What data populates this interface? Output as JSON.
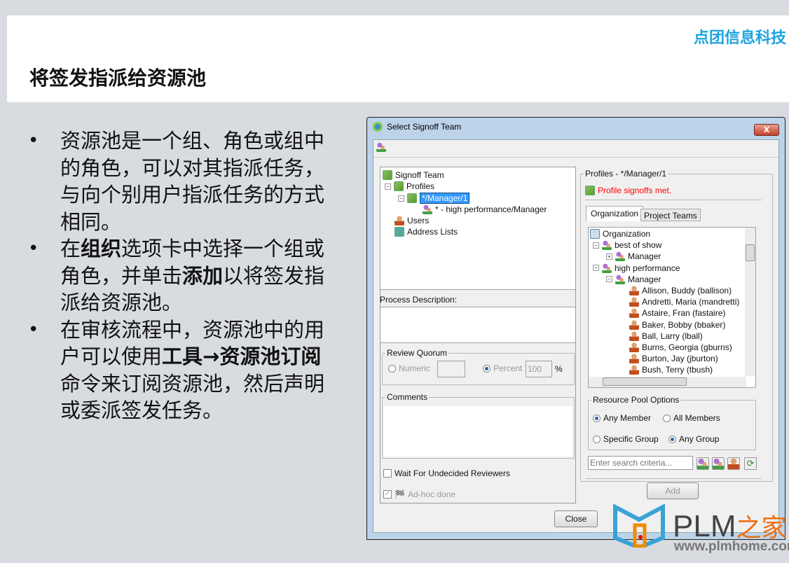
{
  "slide": {
    "brand": "点团信息科技",
    "title": "将签发指派给资源池",
    "bullets": [
      [
        {
          "t": "资源池是一个组、角色或组中的角色，可以对其指派任务，与向个别用户指派任务的方式相同。",
          "b": false
        }
      ],
      [
        {
          "t": "在",
          "b": false
        },
        {
          "t": "组织",
          "b": true
        },
        {
          "t": "选项卡中选择一个组或角色，并单击",
          "b": false
        },
        {
          "t": "添加",
          "b": true
        },
        {
          "t": "以将签发指派给资源池。",
          "b": false
        }
      ],
      [
        {
          "t": "在审核流程中，资源池中的用户可以使用",
          "b": false
        },
        {
          "t": "工具→资源池订阅",
          "b": true
        },
        {
          "t": "命令来订阅资源池，然后声明或委派签发任务。",
          "b": false
        }
      ]
    ]
  },
  "dialog": {
    "title": "Select Signoff Team",
    "close": "X",
    "left_tree": {
      "root": "Signoff Team",
      "profiles": "Profiles",
      "selected": "*/Manager/1",
      "child": "* - high performance/Manager",
      "users": "Users",
      "address_lists": "Address Lists"
    },
    "process_description_label": "Process Description:",
    "review_quorum": {
      "label": "Review Quorum",
      "numeric": "Numeric",
      "numeric_value": "",
      "percent": "Percent",
      "percent_value": "100",
      "percent_unit": "%",
      "selected": "percent"
    },
    "comments_label": "Comments",
    "wait_undecided": {
      "label": "Wait For Undecided Reviewers",
      "checked": false
    },
    "adhoc_done": {
      "label": "Ad-hoc done",
      "checked": true
    },
    "profiles_group": "Profiles - */Manager/1",
    "status": "Profile signoffs met.",
    "status_color": "#ff0000",
    "tabs": [
      {
        "label": "Organization",
        "active": true
      },
      {
        "label": "Project Teams",
        "active": false
      }
    ],
    "org_tree": {
      "root": "Organization",
      "groups": [
        {
          "name": "best of show",
          "roles": [
            "Manager"
          ]
        },
        {
          "name": "high performance",
          "roles": [
            "Manager"
          ]
        }
      ],
      "members": [
        "Allison, Buddy (ballison)",
        "Andretti, Maria (mandretti)",
        "Astaire, Fran (fastaire)",
        "Baker, Bobby (bbaker)",
        "Ball, Larry (lball)",
        "Burns, Georgia (gburns)",
        "Burton, Jay (jburton)",
        "Bush, Terry (tbush)"
      ]
    },
    "resource_pool": {
      "label": "Resource Pool Options",
      "any_member": "Any Member",
      "all_members": "All Members",
      "specific_group": "Specific Group",
      "any_group": "Any Group",
      "member_selected": "any_member",
      "group_selected": "any_group"
    },
    "search_placeholder": "Enter search criteria...",
    "add": "Add",
    "close_button": "Close"
  },
  "watermark": {
    "logo": "PLM之家",
    "url": "www.plmhome.com"
  }
}
